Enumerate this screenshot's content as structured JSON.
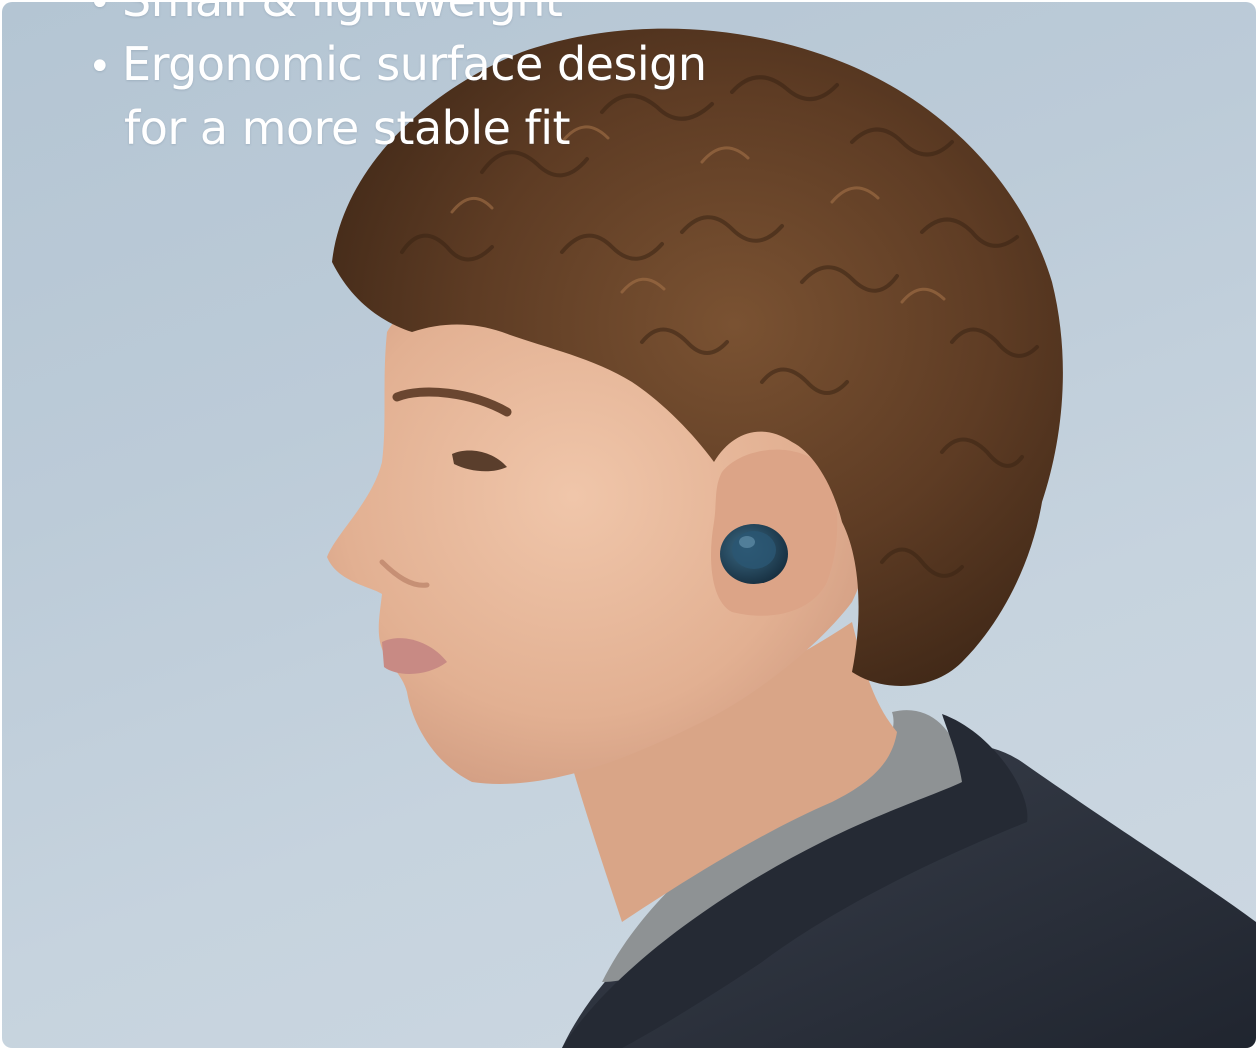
{
  "caption": {
    "bullet_glyph": "•",
    "lines": [
      "Small & lightweight",
      "Ergonomic surface design",
      "for a more stable fit"
    ]
  },
  "colors": {
    "background": "#c1cfdb",
    "text": "#ffffff",
    "hair": "#5a3a22",
    "skin": "#e6b79a",
    "jacket": "#2b313d",
    "sweater": "#8e9294",
    "earbud": "#1f3f55"
  }
}
